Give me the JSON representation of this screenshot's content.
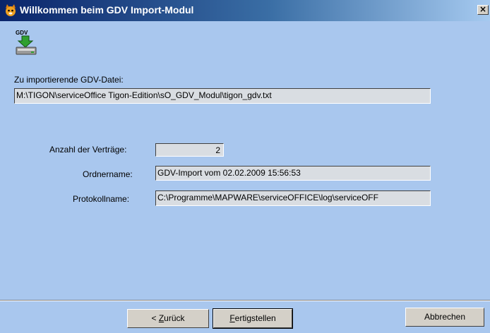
{
  "window": {
    "title": "Willkommen beim GDV Import-Modul",
    "close_glyph": "×",
    "app_icon": "cat-face-icon",
    "logo_icon": "gdv-import-icon",
    "logo_text": "GDV"
  },
  "file": {
    "label": "Zu importierende GDV-Datei:",
    "value": "M:\\TIGON\\serviceOffice Tigon-Edition\\sO_GDV_Modul\\tigon_gdv.txt"
  },
  "details": {
    "count_label": "Anzahl der Verträge:",
    "count_value": "2",
    "folder_label": "Ordnername:",
    "folder_value": "GDV-Import vom 02.02.2009 15:56:53",
    "log_label": "Protokollname:",
    "log_value": "C:\\Programme\\MAPWARE\\serviceOFFICE\\log\\serviceOFF"
  },
  "buttons": {
    "back_prefix": "< ",
    "back_underlined": "Z",
    "back_rest": "urück",
    "finish_underlined": "F",
    "finish_rest": "ertigstellen",
    "cancel": "Abbrechen"
  },
  "colors": {
    "background": "#a9c7ee",
    "titlebar_start": "#0a246a",
    "field_background": "#d9dde2",
    "button_face": "#d4d0c8"
  }
}
